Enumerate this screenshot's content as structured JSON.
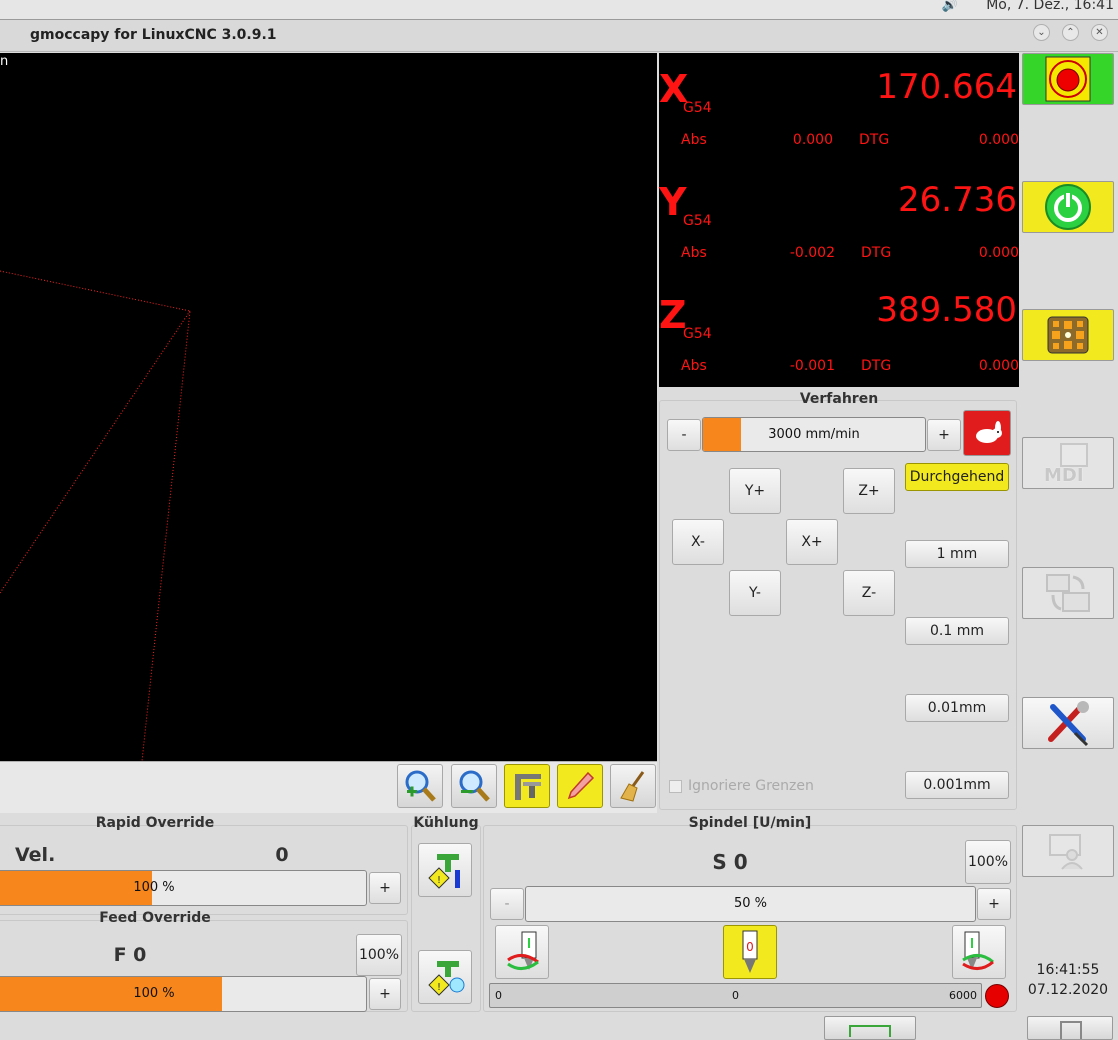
{
  "system": {
    "clock": "Mo,  7. Dez., 16:41"
  },
  "window": {
    "title": "gmoccapy for LinuxCNC  3.0.9.1"
  },
  "preview": {
    "tag": "n"
  },
  "dro": {
    "x": {
      "axis": "X",
      "coord": "G54",
      "value": "170.664",
      "abs_label": "Abs",
      "abs": "0.000",
      "dtg_label": "DTG",
      "dtg": "0.000"
    },
    "y": {
      "axis": "Y",
      "coord": "G54",
      "value": "26.736",
      "abs_label": "Abs",
      "abs": "-0.002",
      "dtg_label": "DTG",
      "dtg": "0.000"
    },
    "z": {
      "axis": "Z",
      "coord": "G54",
      "value": "389.580",
      "abs_label": "Abs",
      "abs": "-0.001",
      "dtg_label": "DTG",
      "dtg": "0.000"
    }
  },
  "jog": {
    "title": "Verfahren",
    "minus": "-",
    "plus": "+",
    "speed": "3000 mm/min",
    "speed_fill_percent": 17,
    "y_plus": "Y+",
    "z_plus": "Z+",
    "x_minus": "X-",
    "x_plus": "X+",
    "y_minus": "Y-",
    "z_minus": "Z-",
    "increments": [
      "Durchgehend",
      "1 mm",
      "0.1 mm",
      "0.01mm",
      "0.001mm"
    ],
    "ignore_limits": "Ignoriere Grenzen"
  },
  "side": {
    "mdi_label": "MDI",
    "clock_time": "16:41:55",
    "clock_date": "07.12.2020"
  },
  "rapid": {
    "title": "Rapid Override",
    "vel_label": "Vel.",
    "vel_value": "0",
    "percent": "100 %",
    "fill_percent": 42,
    "plus": "+"
  },
  "feed": {
    "title": "Feed Override",
    "value": "F 0",
    "reset": "100%",
    "percent": "100 %",
    "fill_percent": 61,
    "plus": "+"
  },
  "coolant": {
    "title": "Kühlung"
  },
  "spindle": {
    "title": "Spindel [U/min]",
    "value": "S 0",
    "reset": "100%",
    "minus": "-",
    "plus": "+",
    "percent": "50 %",
    "fill_percent": 0,
    "gauge_min": "0",
    "gauge_value": "0",
    "gauge_max": "6000"
  },
  "colors": {
    "accent": "#f7861d",
    "dro_text": "#ff1414",
    "estop_bg": "#35d52a",
    "yellow": "#f2ea1e"
  }
}
